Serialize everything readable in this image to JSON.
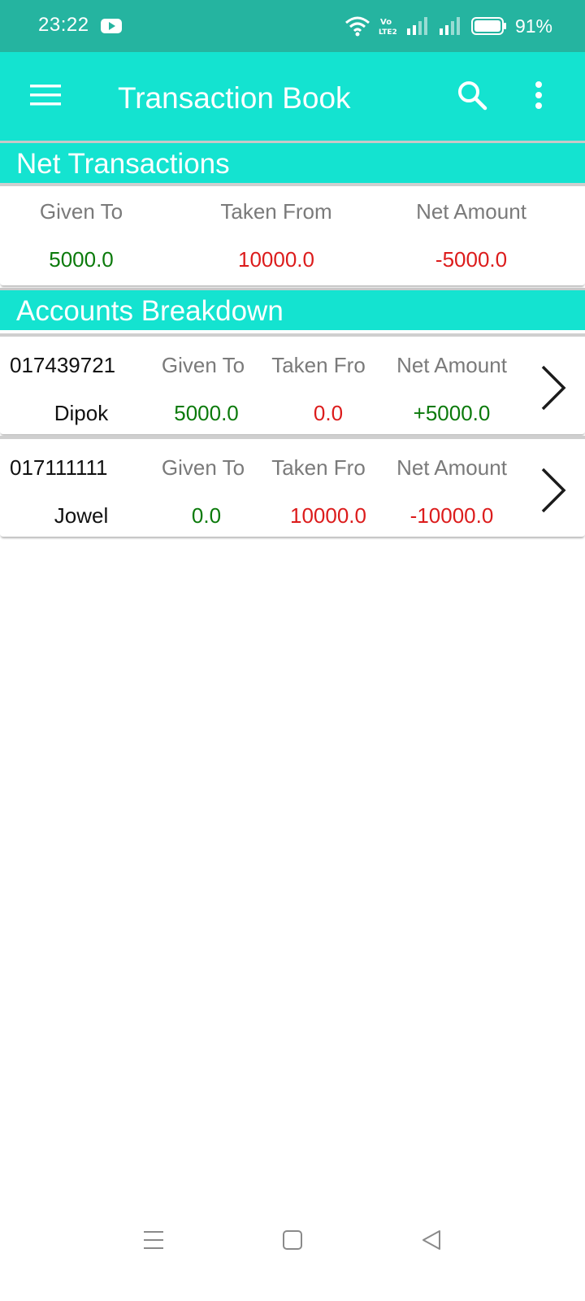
{
  "status_bar": {
    "time": "23:22",
    "battery": "91%",
    "network_badge": "Vo LTE2",
    "icons": [
      "youtube-icon",
      "wifi-icon",
      "signal-icon",
      "battery-icon"
    ]
  },
  "app_bar": {
    "title": "Transaction Book",
    "icons": [
      "menu-icon",
      "search-icon",
      "more-vert-icon"
    ]
  },
  "net_transactions": {
    "header": "Net Transactions",
    "given_label": "Given To",
    "taken_label": "Taken From",
    "net_label": "Net Amount",
    "given_value": "5000.0",
    "taken_value": "10000.0",
    "net_value": "-5000.0"
  },
  "accounts": {
    "header": "Accounts Breakdown",
    "given_label": "Given To",
    "taken_label": "Taken Fro",
    "net_label": "Net Amount",
    "items": [
      {
        "phone": "017439721",
        "name": "Dipok",
        "given": "5000.0",
        "taken": "0.0",
        "net": "+5000.0"
      },
      {
        "phone": "017111111",
        "name": "Jowel",
        "given": "0.0",
        "taken": "10000.0",
        "net": "-10000.0"
      }
    ]
  },
  "colors": {
    "status_bar": "#25b4a0",
    "accent": "#14e3d0",
    "positive": "#0b7a0b",
    "negative": "#dc1c1c"
  },
  "nav_bar": {
    "icons": [
      "recents-icon",
      "home-icon",
      "back-icon"
    ]
  }
}
